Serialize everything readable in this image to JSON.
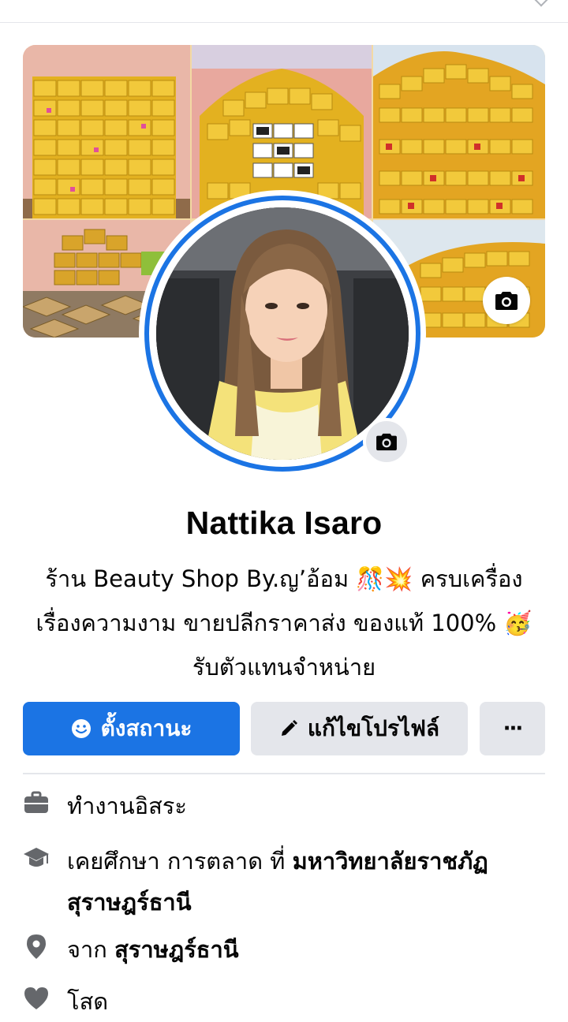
{
  "profile": {
    "name": "Nattika Isaro",
    "bio_line1": "ร้าน Beauty Shop By.ญ’อ้อม 🎊💥 ครบเครื่อง",
    "bio_line2": "เรื่องความงาม ขายปลีกราคาส่ง ของแท้ 100% 🥳",
    "bio_line3": "รับตัวแทนจำหน่าย"
  },
  "actions": {
    "status_label": "ตั้งสถานะ",
    "edit_label": "แก้ไขโปรไฟล์",
    "more_label": "···"
  },
  "about": {
    "work": "ทำงานอิสระ",
    "education_prefix": "เคยศึกษา การตลาด ที่ ",
    "education_school_line1": "มหาวิทยาลัยราชภัฏ",
    "education_school_line2": "สุราษฎร์ธานี",
    "from_prefix": "จาก ",
    "from_place": "สุราษฎร์ธานี",
    "relationship": "โสด"
  },
  "icons": {
    "cover_camera": "camera-icon",
    "avatar_camera": "camera-icon",
    "status": "smiley-icon",
    "edit": "pencil-icon",
    "work": "briefcase-icon",
    "education": "graduation-cap-icon",
    "location": "map-pin-icon",
    "relationship": "heart-icon"
  },
  "colors": {
    "primary": "#1b74e4",
    "secondary_button": "#e4e6eb",
    "icon_gray": "#65676b",
    "text": "#050505"
  }
}
